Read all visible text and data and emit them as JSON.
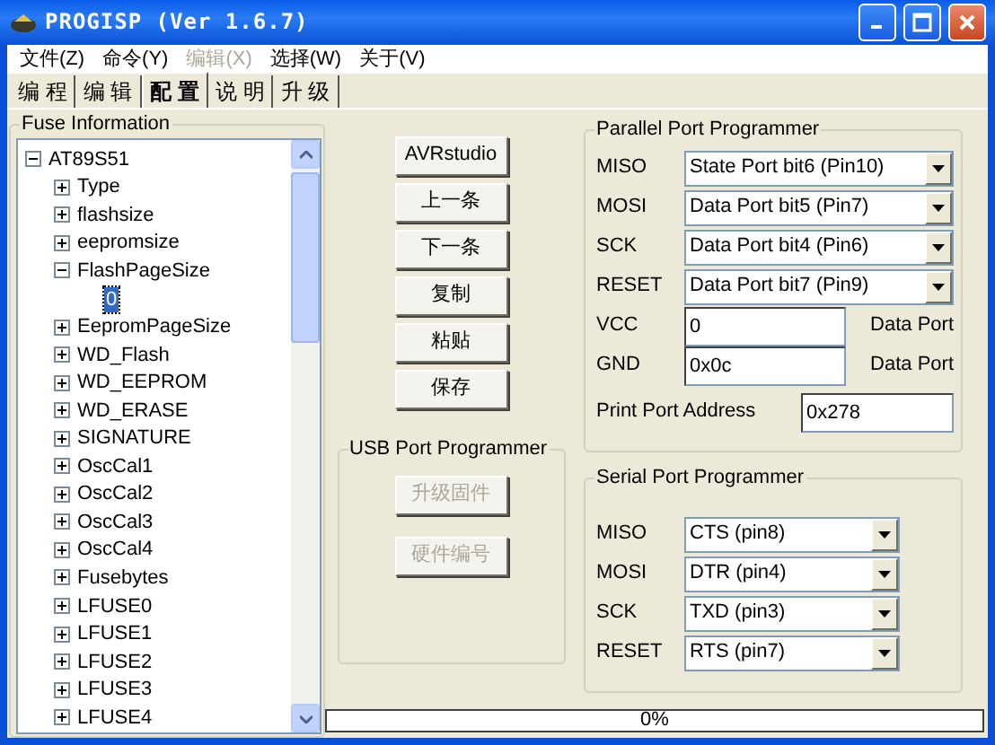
{
  "window": {
    "title": "PROGISP (Ver 1.6.7)"
  },
  "menu": [
    {
      "label": "文件(Z)",
      "disabled": false
    },
    {
      "label": "命令(Y)",
      "disabled": false
    },
    {
      "label": "编辑(X)",
      "disabled": true
    },
    {
      "label": "选择(W)",
      "disabled": false
    },
    {
      "label": "关于(V)",
      "disabled": false
    }
  ],
  "tabs": [
    {
      "label": "编 程",
      "selected": false
    },
    {
      "label": "编 辑",
      "selected": false
    },
    {
      "label": "配 置",
      "selected": true
    },
    {
      "label": "说 明",
      "selected": false
    },
    {
      "label": "升 级",
      "selected": false
    }
  ],
  "fuse_information": {
    "title": "Fuse Information",
    "tree": [
      {
        "label": "AT89S51",
        "expanded": true,
        "selected": false,
        "children": [
          {
            "label": "Type",
            "expanded": false,
            "selected": false
          },
          {
            "label": "flashsize",
            "expanded": false,
            "selected": false
          },
          {
            "label": "eepromsize",
            "expanded": false,
            "selected": false
          },
          {
            "label": "FlashPageSize",
            "expanded": true,
            "selected": false,
            "children": [
              {
                "label": "0",
                "selected": true
              }
            ]
          },
          {
            "label": "EepromPageSize",
            "expanded": false,
            "selected": false
          },
          {
            "label": "WD_Flash",
            "expanded": false,
            "selected": false
          },
          {
            "label": "WD_EEPROM",
            "expanded": false,
            "selected": false
          },
          {
            "label": "WD_ERASE",
            "expanded": false,
            "selected": false
          },
          {
            "label": "SIGNATURE",
            "expanded": false,
            "selected": false
          },
          {
            "label": "OscCal1",
            "expanded": false,
            "selected": false
          },
          {
            "label": "OscCal2",
            "expanded": false,
            "selected": false
          },
          {
            "label": "OscCal3",
            "expanded": false,
            "selected": false
          },
          {
            "label": "OscCal4",
            "expanded": false,
            "selected": false
          },
          {
            "label": "Fusebytes",
            "expanded": false,
            "selected": false
          },
          {
            "label": "LFUSE0",
            "expanded": false,
            "selected": false
          },
          {
            "label": "LFUSE1",
            "expanded": false,
            "selected": false
          },
          {
            "label": "LFUSE2",
            "expanded": false,
            "selected": false
          },
          {
            "label": "LFUSE3",
            "expanded": false,
            "selected": false
          },
          {
            "label": "LFUSE4",
            "expanded": false,
            "selected": false
          }
        ]
      }
    ]
  },
  "buttons": [
    {
      "label": "AVRstudio",
      "disabled": false
    },
    {
      "label": "上一条",
      "disabled": false
    },
    {
      "label": "下一条",
      "disabled": false
    },
    {
      "label": "复制",
      "disabled": false
    },
    {
      "label": "粘贴",
      "disabled": false
    },
    {
      "label": "保存",
      "disabled": false
    }
  ],
  "usb_port_programmer": {
    "title": "USB Port Programmer",
    "buttons": [
      {
        "label": "升级固件",
        "disabled": true
      },
      {
        "label": "硬件编号",
        "disabled": true
      }
    ]
  },
  "parallel_port_programmer": {
    "title": "Parallel Port Programmer",
    "pins": [
      {
        "label": "MISO",
        "value": "State Port bit6 (Pin10)"
      },
      {
        "label": "MOSI",
        "value": "Data Port bit5 (Pin7)"
      },
      {
        "label": "SCK",
        "value": "Data Port bit4 (Pin6)"
      },
      {
        "label": "RESET",
        "value": "Data Port bit7 (Pin9)"
      }
    ],
    "power": [
      {
        "label": "VCC",
        "value": "0",
        "port": "Data Port"
      },
      {
        "label": "GND",
        "value": "0x0c",
        "port": "Data Port"
      }
    ],
    "print_port_address": {
      "label": "Print Port Address",
      "value": "0x278"
    }
  },
  "serial_port_programmer": {
    "title": "Serial Port Programmer",
    "pins": [
      {
        "label": "MISO",
        "value": "CTS (pin8)"
      },
      {
        "label": "MOSI",
        "value": "DTR (pin4)"
      },
      {
        "label": "SCK",
        "value": "TXD (pin3)"
      },
      {
        "label": "RESET",
        "value": "RTS (pin7)"
      }
    ]
  },
  "progress": {
    "reading": "0%",
    "level": 0
  }
}
